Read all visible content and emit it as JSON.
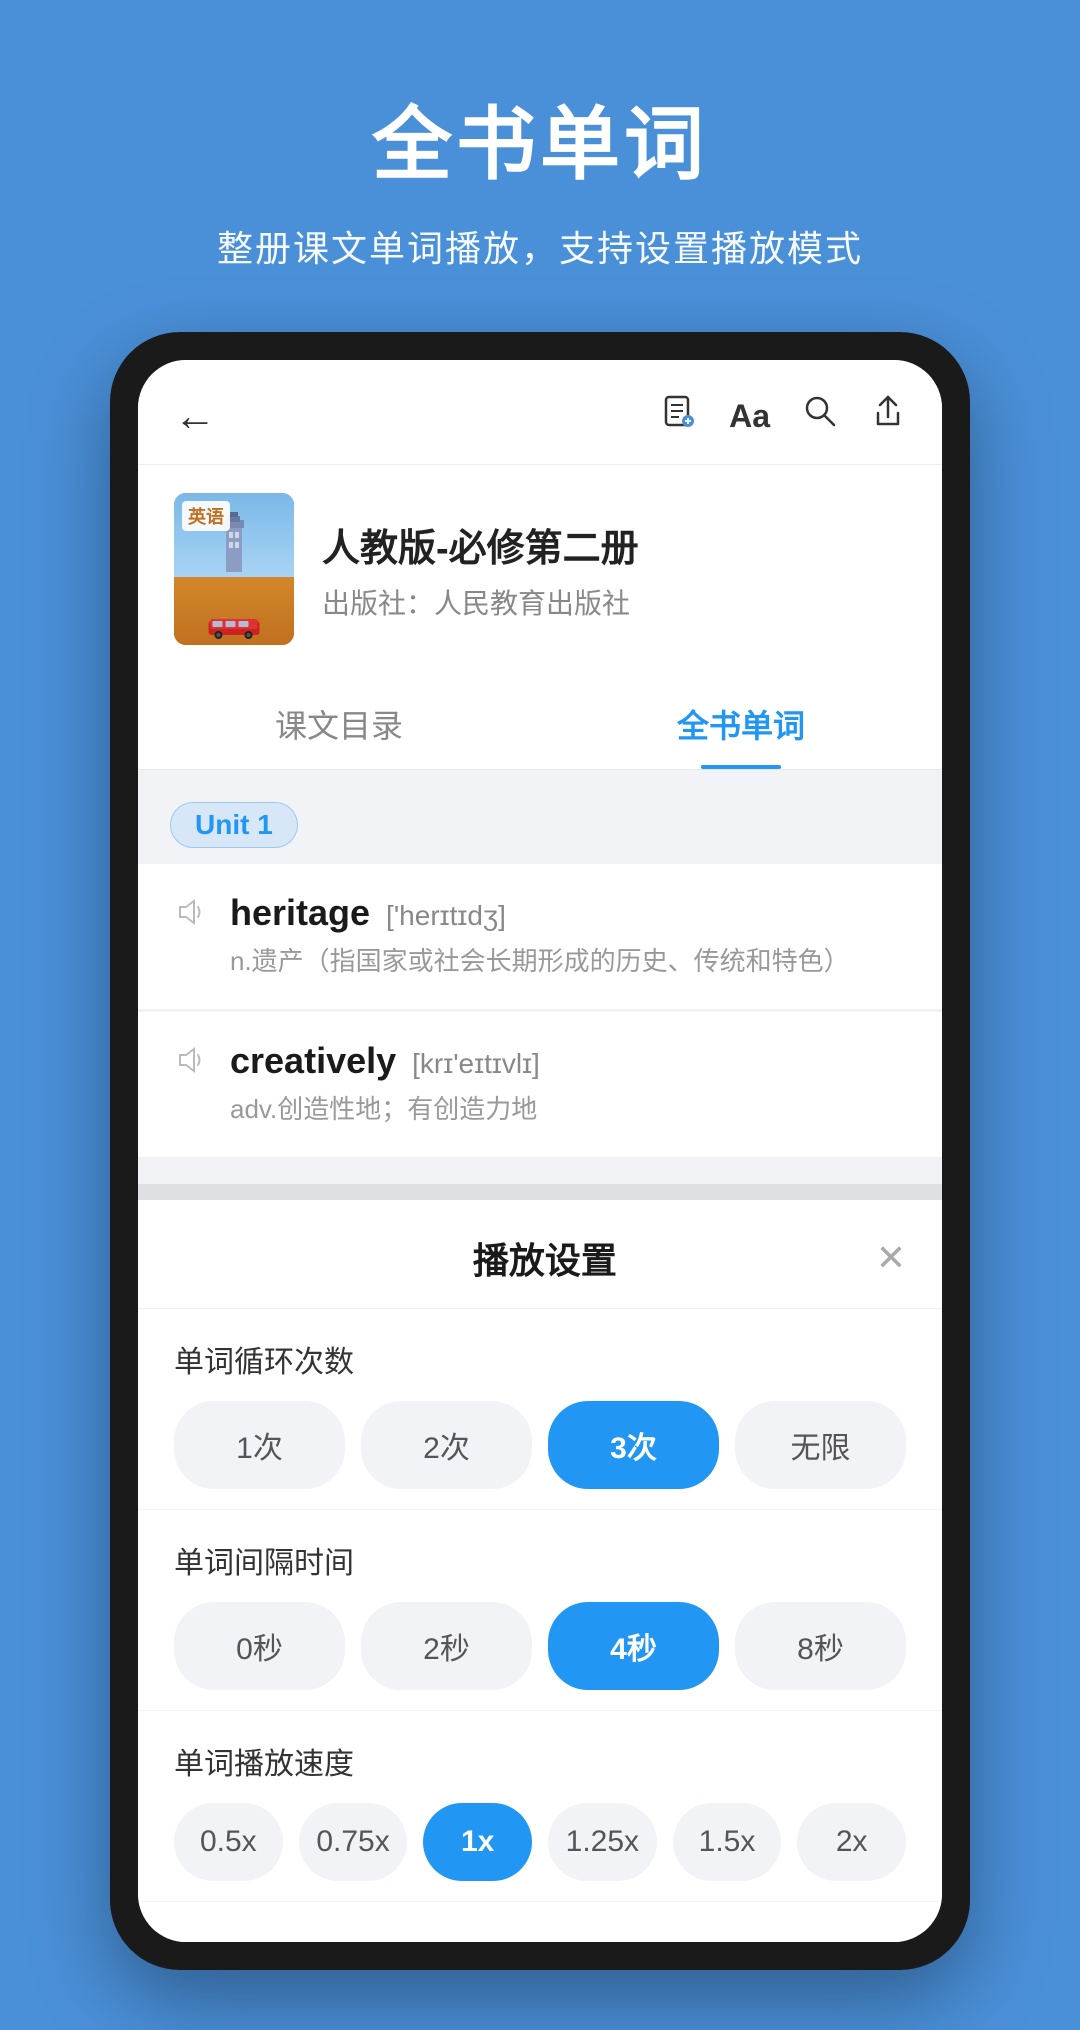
{
  "page": {
    "background_color": "#4A90D9"
  },
  "top": {
    "main_title": "全书单词",
    "sub_title": "整册课文单词播放，支持设置播放模式"
  },
  "app": {
    "header": {
      "back_label": "←",
      "icon1": "📋",
      "icon2": "Aa",
      "icon3": "🔍",
      "icon4": "⬆"
    },
    "book": {
      "title": "人教版-必修第二册",
      "publisher": "出版社：人民教育出版社",
      "label": "英语"
    },
    "tabs": [
      {
        "id": "catalog",
        "label": "课文目录",
        "active": false
      },
      {
        "id": "words",
        "label": "全书单词",
        "active": true
      }
    ],
    "unit_badge": "Unit 1",
    "words": [
      {
        "word": "heritage",
        "phonetic": "['herɪtɪdʒ]",
        "definition": "n.遗产（指国家或社会长期形成的历史、传统和特色）"
      },
      {
        "word": "creatively",
        "phonetic": "[krɪ'eɪtɪvlɪ]",
        "definition": "adv.创造性地；有创造力地"
      }
    ],
    "settings_sheet": {
      "title": "播放设置",
      "close_label": "✕",
      "sections": [
        {
          "id": "repeat",
          "label": "单词循环次数",
          "options": [
            "1次",
            "2次",
            "3次",
            "无限"
          ],
          "active_index": 2
        },
        {
          "id": "interval",
          "label": "单词间隔时间",
          "options": [
            "0秒",
            "2秒",
            "4秒",
            "8秒"
          ],
          "active_index": 2
        },
        {
          "id": "speed",
          "label": "单词播放速度",
          "options": [
            "0.5x",
            "0.75x",
            "1x",
            "1.25x",
            "1.5x",
            "2x"
          ],
          "active_index": 2
        }
      ]
    }
  }
}
